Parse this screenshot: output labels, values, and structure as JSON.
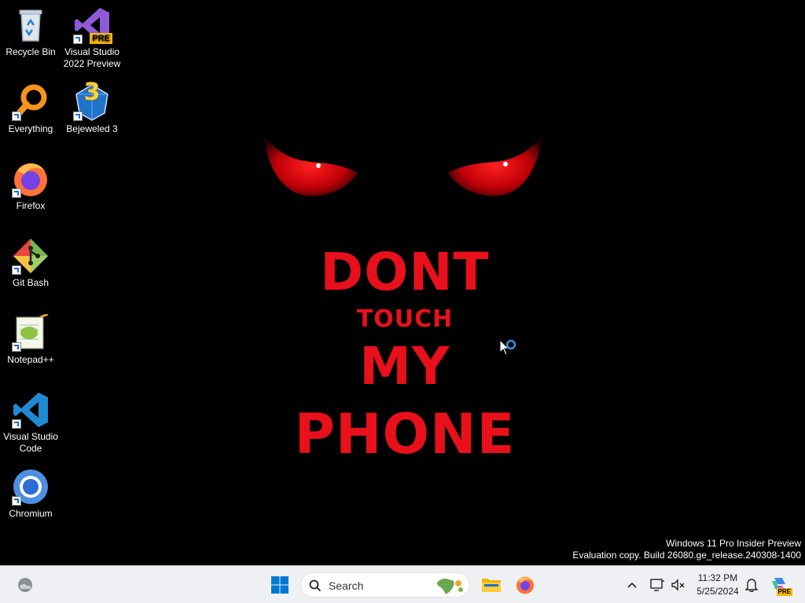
{
  "desktop": {
    "icons": [
      {
        "label": "Recycle Bin",
        "icon": "recycle-bin-icon"
      },
      {
        "label": "Visual Studio 2022 Preview",
        "icon": "visual-studio-preview-icon",
        "badge": "PRE"
      },
      {
        "label": "Everything",
        "icon": "everything-search-icon"
      },
      {
        "label": "Bejeweled 3",
        "icon": "bejeweled-icon",
        "badge": "3"
      },
      {
        "label": "Firefox",
        "icon": "firefox-icon"
      },
      {
        "label": "Git Bash",
        "icon": "git-bash-icon"
      },
      {
        "label": "Notepad++",
        "icon": "notepad-plus-plus-icon"
      },
      {
        "label": "Visual Studio Code",
        "icon": "vscode-icon"
      },
      {
        "label": "Chromium",
        "icon": "chromium-icon"
      }
    ]
  },
  "wallpaper": {
    "lines": [
      "DONT",
      "TOUCH",
      "MY",
      "PHONE"
    ],
    "text_color": "#e8101a"
  },
  "watermark": {
    "line1": "Windows 11 Pro Insider Preview",
    "line2": "Evaluation copy. Build 26080.ge_release.240308-1400"
  },
  "taskbar": {
    "search_placeholder": "Search",
    "clock_time": "11:32 PM",
    "clock_date": "5/25/2024",
    "copilot_badge": "PRE",
    "accent": "#0067c0"
  }
}
